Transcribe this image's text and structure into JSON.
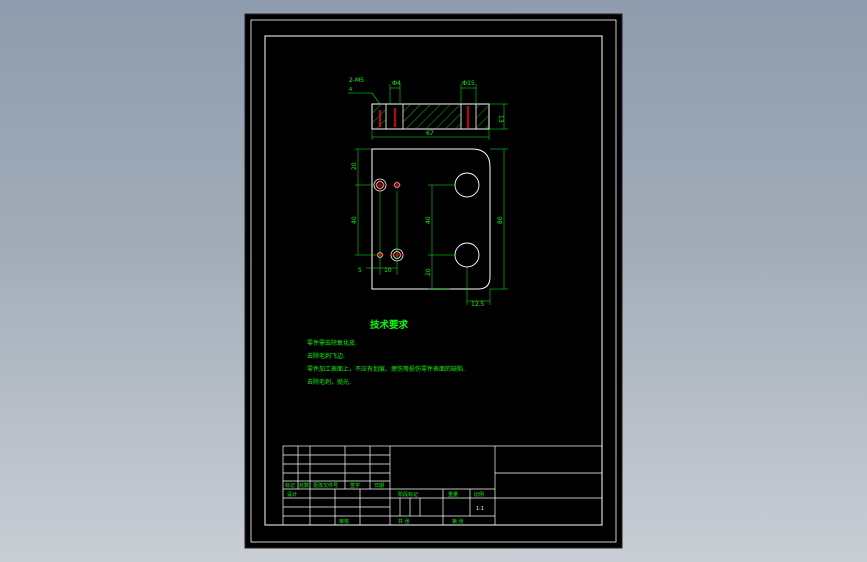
{
  "colors": {
    "background_top": "#8e9cad",
    "background_bottom": "#c9ced5",
    "sheet": "#000000",
    "frame_line": "#ffffff",
    "dimension": "#00ff00",
    "hatch": "#00ff00",
    "center_mark": "#ff0000",
    "body_text": "#00ff00",
    "title_block_line": "#ffffff"
  },
  "drawing": {
    "top_view_dims": {
      "note_tapped": "2-M5",
      "note_depth": "4",
      "dia_small": "Ф4",
      "dia_large": "Ф15",
      "overall_length": "67",
      "thickness": "13"
    },
    "front_view_dims": {
      "top_offset": "20",
      "hole_pitch_left": "40",
      "hole_pitch_right": "40",
      "overall_height": "80",
      "bottom_offset": "20",
      "left_offset": "5",
      "hole_spacing": "10",
      "right_edge": "12.5"
    }
  },
  "notes": {
    "title": "技术要求",
    "lines": [
      "零件需去除氧化皮.",
      "去除毛刺飞边.",
      "零件加工表面上，不应有划痕、擦伤等损伤零件表面的缺陷.",
      "去除毛刺，抛光."
    ]
  },
  "title_block": {
    "row_labels": [
      "标记",
      "处数",
      "更改文件号",
      "签字",
      "日期"
    ],
    "designer": "设计",
    "mark_cols": [
      "阶段标记",
      "重量",
      "比例"
    ],
    "scale": "1:1",
    "review": "审核",
    "process": "工艺",
    "approve": "批准",
    "sheet_total": "共  张",
    "sheet_no": "第  张"
  }
}
